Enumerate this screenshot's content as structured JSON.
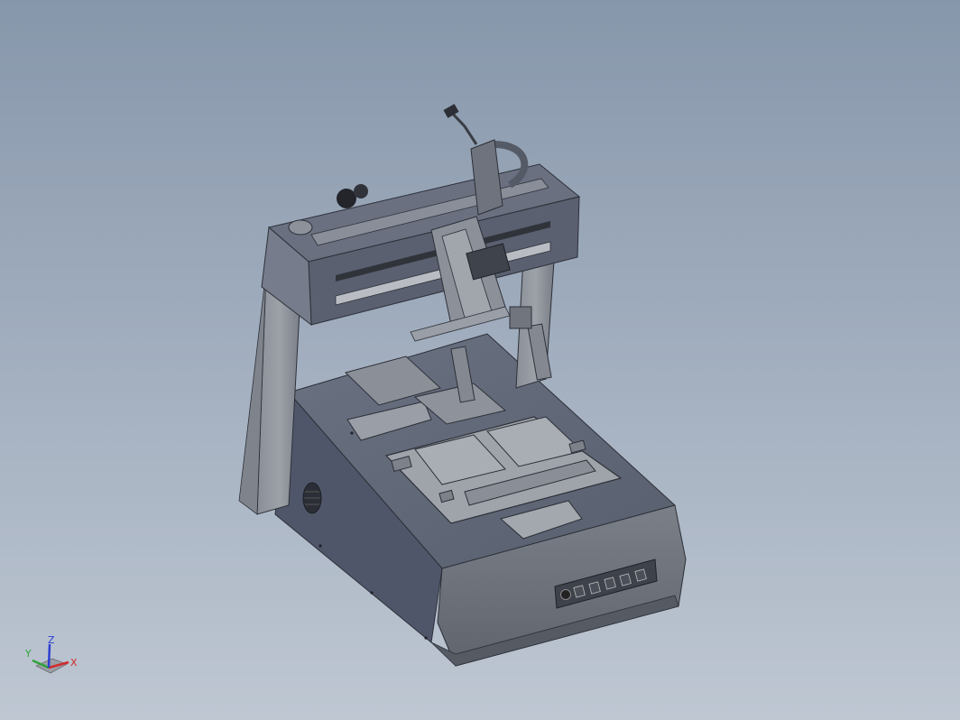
{
  "viewport": {
    "background_top": "#8797ab",
    "background_bottom": "#bec7d2"
  },
  "model": {
    "subject": "desktop-3-axis-dispensing-robot",
    "body_color": "#5d6473",
    "frame_color": "#6f7685",
    "panel_buttons": 5
  },
  "triad": {
    "x_label": "X",
    "y_label": "Y",
    "z_label": "Z",
    "x_color": "#d22b2b",
    "y_color": "#2fa33a",
    "z_color": "#2b3fd2"
  }
}
